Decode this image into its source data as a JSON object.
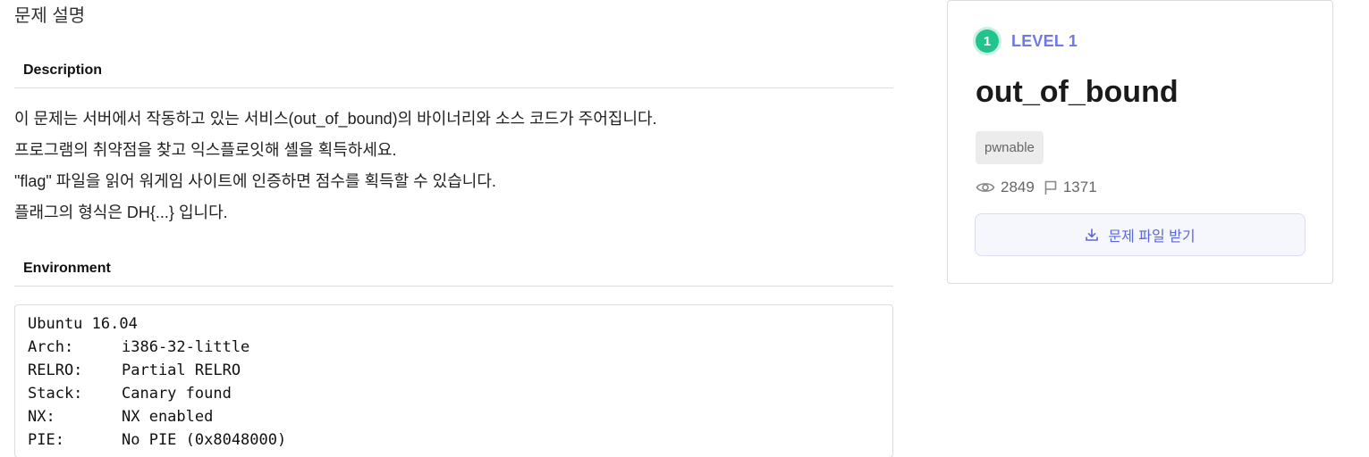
{
  "page_title": "문제 설명",
  "description": {
    "heading": "Description",
    "lines": [
      "이 문제는 서버에서 작동하고 있는 서비스(out_of_bound)의 바이너리와 소스 코드가 주어집니다.",
      "프로그램의 취약점을 찾고 익스플로잇해 셸을 획득하세요.",
      "\"flag\" 파일을 읽어 워게임 사이트에 인증하면 점수를 획득할 수 있습니다.",
      "플래그의 형식은 DH{...} 입니다."
    ]
  },
  "environment": {
    "heading": "Environment",
    "first_line": "Ubuntu 16.04",
    "rows": [
      {
        "key": "Arch:",
        "value": "i386-32-little"
      },
      {
        "key": "RELRO:",
        "value": "Partial RELRO"
      },
      {
        "key": "Stack:",
        "value": "Canary found"
      },
      {
        "key": "NX:",
        "value": "NX enabled"
      },
      {
        "key": "PIE:",
        "value": "No PIE (0x8048000)"
      }
    ]
  },
  "card": {
    "level_number": "1",
    "level_label": "LEVEL 1",
    "title": "out_of_bound",
    "tag": "pwnable",
    "views": "2849",
    "solves": "1371",
    "download_label": "문제 파일 받기",
    "icons": {
      "views": "eye-icon",
      "solves": "flag-icon",
      "download": "download-icon"
    },
    "colors": {
      "level_badge": "#22c38e",
      "level_text": "#6e78e8",
      "download_text": "#5b67d8"
    }
  }
}
